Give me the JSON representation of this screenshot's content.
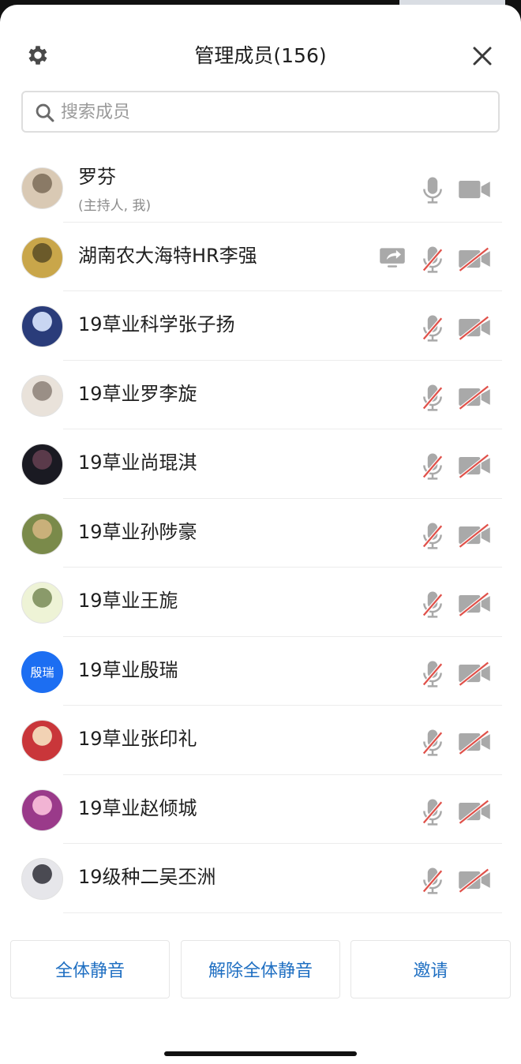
{
  "header": {
    "title": "管理成员(156)",
    "settings_icon": "gear-icon",
    "close_icon": "close-icon"
  },
  "search": {
    "placeholder": "搜索成员"
  },
  "colors": {
    "muted_icon": "#a9a9a9",
    "muted_slash": "#e0514a",
    "accent_text": "#1f6fc2",
    "initials_avatar": "#1c6ef2"
  },
  "members": [
    {
      "name": "罗芬",
      "subtitle": "(主持人, 我)",
      "mic": "on",
      "camera": "on",
      "sharing": false,
      "avatar": "photo"
    },
    {
      "name": "湖南农大海特HR李强",
      "mic": "muted",
      "camera": "off",
      "sharing": true,
      "avatar": "photo"
    },
    {
      "name": "19草业科学张子扬",
      "mic": "muted",
      "camera": "off",
      "sharing": false,
      "avatar": "photo"
    },
    {
      "name": "19草业罗李旋",
      "mic": "muted",
      "camera": "off",
      "sharing": false,
      "avatar": "photo"
    },
    {
      "name": "19草业尚琨淇",
      "mic": "muted",
      "camera": "off",
      "sharing": false,
      "avatar": "photo"
    },
    {
      "name": "19草业孙陟豪",
      "mic": "muted",
      "camera": "off",
      "sharing": false,
      "avatar": "photo"
    },
    {
      "name": "19草业王旎",
      "mic": "muted",
      "camera": "off",
      "sharing": false,
      "avatar": "photo"
    },
    {
      "name": "19草业殷瑞",
      "mic": "muted",
      "camera": "off",
      "sharing": false,
      "avatar": "initials",
      "initials": "殷瑞"
    },
    {
      "name": "19草业张印礼",
      "mic": "muted",
      "camera": "off",
      "sharing": false,
      "avatar": "photo"
    },
    {
      "name": "19草业赵倾城",
      "mic": "muted",
      "camera": "off",
      "sharing": false,
      "avatar": "photo"
    },
    {
      "name": "19级种二吴丕洲",
      "mic": "muted",
      "camera": "off",
      "sharing": false,
      "avatar": "photo"
    }
  ],
  "footer": {
    "mute_all": "全体静音",
    "unmute_all": "解除全体静音",
    "invite": "邀请"
  }
}
